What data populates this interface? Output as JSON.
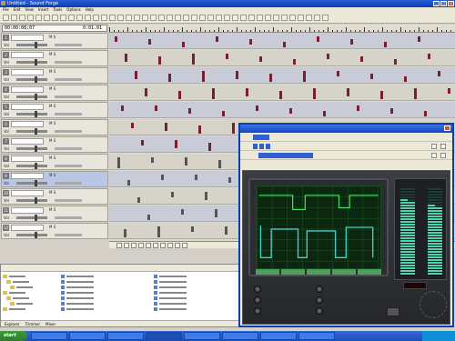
{
  "window": {
    "title": "Untitled - Sound Forge",
    "buttons": [
      "_",
      "□",
      "×"
    ]
  },
  "menu": [
    "File",
    "Edit",
    "View",
    "Insert",
    "Tools",
    "Options",
    "Help"
  ],
  "transport": {
    "time": "00:00:08;07",
    "time_secondary": "0:01.01"
  },
  "tracks": [
    {
      "num": "1",
      "name": "",
      "vol": "Vol",
      "ctl": "M S"
    },
    {
      "num": "2",
      "name": "",
      "vol": "Vol",
      "ctl": "M S"
    },
    {
      "num": "3",
      "name": "",
      "vol": "Vol",
      "ctl": "M S"
    },
    {
      "num": "4",
      "name": "",
      "vol": "Vol",
      "ctl": "M S"
    },
    {
      "num": "5",
      "name": "",
      "vol": "Vol",
      "ctl": "M S"
    },
    {
      "num": "6",
      "name": "",
      "vol": "Vol",
      "ctl": "M S"
    },
    {
      "num": "7",
      "name": "",
      "vol": "Vol",
      "ctl": "M S"
    },
    {
      "num": "8",
      "name": "",
      "vol": "Vol",
      "ctl": "M S"
    },
    {
      "num": "9",
      "name": "",
      "vol": "Vol",
      "ctl": "M S"
    },
    {
      "num": "10",
      "name": "",
      "vol": "Vol",
      "ctl": "M S"
    },
    {
      "num": "11",
      "name": "",
      "vol": "Vol",
      "ctl": "M S"
    },
    {
      "num": "12",
      "name": "",
      "vol": "Vol",
      "ctl": "M S"
    }
  ],
  "explorer": {
    "tabs": [
      "Explorer",
      "Trimmer",
      "Mixer"
    ]
  },
  "plugin": {
    "title": "",
    "preset": "",
    "unit_brand": "",
    "screen_buttons": [
      "",
      "",
      "",
      "",
      ""
    ],
    "readout": "",
    "meter_left": "",
    "meter_right": ""
  },
  "taskbar": {
    "start": "start",
    "tasks": [
      "",
      "",
      "",
      "",
      "",
      "",
      "",
      ""
    ],
    "clock": ""
  },
  "colors": {
    "accent": "#0a3db8",
    "scope_green": "#4ee06a",
    "scope_cyan": "#3fd2c8",
    "meter": "#4fd3b0",
    "event_maroon": "#7a1f2e"
  }
}
